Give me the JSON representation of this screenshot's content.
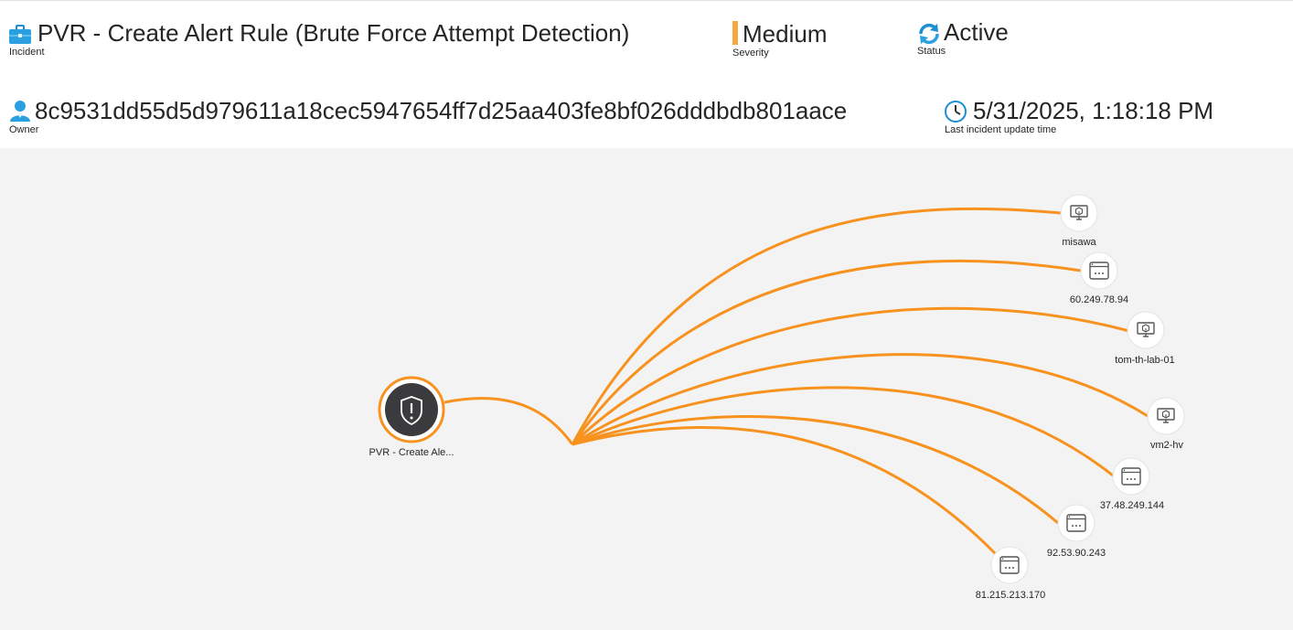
{
  "incident": {
    "title": "PVR - Create Alert Rule (Brute Force Attempt Detection)",
    "title_label": "Incident",
    "severity": "Medium",
    "severity_label": "Severity",
    "severity_color": "#f7a641",
    "status": "Active",
    "status_label": "Status",
    "owner": "8c9531dd55d5d979611a18cec5947654ff7d25aa403fe8bf026dddbdb801aace",
    "owner_label": "Owner",
    "last_update": "5/31/2025, 1:18:18 PM",
    "last_update_label": "Last incident update time"
  },
  "icons": {
    "incident": "briefcase-icon",
    "severity": "severity-bar-icon",
    "status": "refresh-icon",
    "owner": "person-icon",
    "last_update": "clock-icon"
  },
  "graph": {
    "edge_color": "#f7921e",
    "center_node": {
      "label": "PVR - Create Ale...",
      "icon": "shield-alert-icon"
    },
    "entities": [
      {
        "label": "misawa",
        "icon": "host-icon"
      },
      {
        "label": "60.249.78.94",
        "icon": "ip-icon"
      },
      {
        "label": "tom-th-lab-01",
        "icon": "host-icon"
      },
      {
        "label": "vm2-hv",
        "icon": "host-icon"
      },
      {
        "label": "37.48.249.144",
        "icon": "ip-icon"
      },
      {
        "label": "92.53.90.243",
        "icon": "ip-icon"
      },
      {
        "label": "81.215.213.170",
        "icon": "ip-icon"
      }
    ]
  }
}
